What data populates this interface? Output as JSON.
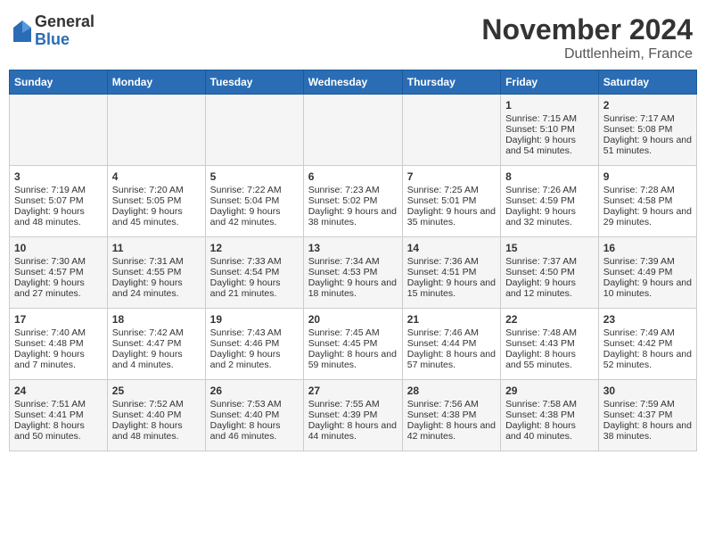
{
  "header": {
    "logo_general": "General",
    "logo_blue": "Blue",
    "month_title": "November 2024",
    "location": "Duttlenheim, France"
  },
  "weekdays": [
    "Sunday",
    "Monday",
    "Tuesday",
    "Wednesday",
    "Thursday",
    "Friday",
    "Saturday"
  ],
  "weeks": [
    [
      {
        "day": "",
        "info": ""
      },
      {
        "day": "",
        "info": ""
      },
      {
        "day": "",
        "info": ""
      },
      {
        "day": "",
        "info": ""
      },
      {
        "day": "",
        "info": ""
      },
      {
        "day": "1",
        "info": "Sunrise: 7:15 AM\nSunset: 5:10 PM\nDaylight: 9 hours and 54 minutes."
      },
      {
        "day": "2",
        "info": "Sunrise: 7:17 AM\nSunset: 5:08 PM\nDaylight: 9 hours and 51 minutes."
      }
    ],
    [
      {
        "day": "3",
        "info": "Sunrise: 7:19 AM\nSunset: 5:07 PM\nDaylight: 9 hours and 48 minutes."
      },
      {
        "day": "4",
        "info": "Sunrise: 7:20 AM\nSunset: 5:05 PM\nDaylight: 9 hours and 45 minutes."
      },
      {
        "day": "5",
        "info": "Sunrise: 7:22 AM\nSunset: 5:04 PM\nDaylight: 9 hours and 42 minutes."
      },
      {
        "day": "6",
        "info": "Sunrise: 7:23 AM\nSunset: 5:02 PM\nDaylight: 9 hours and 38 minutes."
      },
      {
        "day": "7",
        "info": "Sunrise: 7:25 AM\nSunset: 5:01 PM\nDaylight: 9 hours and 35 minutes."
      },
      {
        "day": "8",
        "info": "Sunrise: 7:26 AM\nSunset: 4:59 PM\nDaylight: 9 hours and 32 minutes."
      },
      {
        "day": "9",
        "info": "Sunrise: 7:28 AM\nSunset: 4:58 PM\nDaylight: 9 hours and 29 minutes."
      }
    ],
    [
      {
        "day": "10",
        "info": "Sunrise: 7:30 AM\nSunset: 4:57 PM\nDaylight: 9 hours and 27 minutes."
      },
      {
        "day": "11",
        "info": "Sunrise: 7:31 AM\nSunset: 4:55 PM\nDaylight: 9 hours and 24 minutes."
      },
      {
        "day": "12",
        "info": "Sunrise: 7:33 AM\nSunset: 4:54 PM\nDaylight: 9 hours and 21 minutes."
      },
      {
        "day": "13",
        "info": "Sunrise: 7:34 AM\nSunset: 4:53 PM\nDaylight: 9 hours and 18 minutes."
      },
      {
        "day": "14",
        "info": "Sunrise: 7:36 AM\nSunset: 4:51 PM\nDaylight: 9 hours and 15 minutes."
      },
      {
        "day": "15",
        "info": "Sunrise: 7:37 AM\nSunset: 4:50 PM\nDaylight: 9 hours and 12 minutes."
      },
      {
        "day": "16",
        "info": "Sunrise: 7:39 AM\nSunset: 4:49 PM\nDaylight: 9 hours and 10 minutes."
      }
    ],
    [
      {
        "day": "17",
        "info": "Sunrise: 7:40 AM\nSunset: 4:48 PM\nDaylight: 9 hours and 7 minutes."
      },
      {
        "day": "18",
        "info": "Sunrise: 7:42 AM\nSunset: 4:47 PM\nDaylight: 9 hours and 4 minutes."
      },
      {
        "day": "19",
        "info": "Sunrise: 7:43 AM\nSunset: 4:46 PM\nDaylight: 9 hours and 2 minutes."
      },
      {
        "day": "20",
        "info": "Sunrise: 7:45 AM\nSunset: 4:45 PM\nDaylight: 8 hours and 59 minutes."
      },
      {
        "day": "21",
        "info": "Sunrise: 7:46 AM\nSunset: 4:44 PM\nDaylight: 8 hours and 57 minutes."
      },
      {
        "day": "22",
        "info": "Sunrise: 7:48 AM\nSunset: 4:43 PM\nDaylight: 8 hours and 55 minutes."
      },
      {
        "day": "23",
        "info": "Sunrise: 7:49 AM\nSunset: 4:42 PM\nDaylight: 8 hours and 52 minutes."
      }
    ],
    [
      {
        "day": "24",
        "info": "Sunrise: 7:51 AM\nSunset: 4:41 PM\nDaylight: 8 hours and 50 minutes."
      },
      {
        "day": "25",
        "info": "Sunrise: 7:52 AM\nSunset: 4:40 PM\nDaylight: 8 hours and 48 minutes."
      },
      {
        "day": "26",
        "info": "Sunrise: 7:53 AM\nSunset: 4:40 PM\nDaylight: 8 hours and 46 minutes."
      },
      {
        "day": "27",
        "info": "Sunrise: 7:55 AM\nSunset: 4:39 PM\nDaylight: 8 hours and 44 minutes."
      },
      {
        "day": "28",
        "info": "Sunrise: 7:56 AM\nSunset: 4:38 PM\nDaylight: 8 hours and 42 minutes."
      },
      {
        "day": "29",
        "info": "Sunrise: 7:58 AM\nSunset: 4:38 PM\nDaylight: 8 hours and 40 minutes."
      },
      {
        "day": "30",
        "info": "Sunrise: 7:59 AM\nSunset: 4:37 PM\nDaylight: 8 hours and 38 minutes."
      }
    ]
  ]
}
